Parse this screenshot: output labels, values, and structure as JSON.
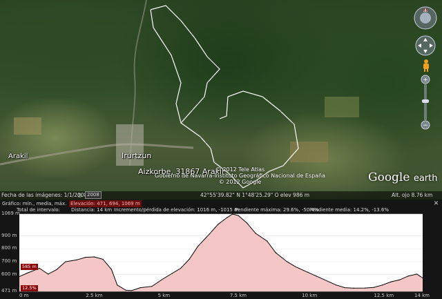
{
  "map": {
    "places": {
      "irurtzun": "Irurtzun",
      "arakil": "Arakil",
      "aizkorbe": "Aizkorbe, 31867 Arakil"
    },
    "attribution": {
      "line1": "© 2012 Tele Atlas",
      "line2": "Gobierno de Navarra-Instituto Geográfico Nacional de España",
      "line3": "© 2012 Google"
    },
    "logo": {
      "main": "Google",
      "suffix": "earth"
    },
    "status": {
      "imagery_date": "Fecha de las imágenes: 1/1/2008",
      "year": "2008",
      "coords": "42°55'39.82\" N    1°48'25.29\" O  elev  986 m",
      "eye_alt": "Alt. ojo    8.76 km"
    },
    "nav_icons": [
      "look-compass-icon",
      "move-compass-icon",
      "pegman-icon",
      "zoom-slider-icon"
    ]
  },
  "profile": {
    "toolbar": {
      "graph_label": "Gráfico: mín., media, máx.",
      "elevation": "Elevación: 471, 694, 1069 m",
      "total_label": "Total de intervalo:",
      "distance": "Distancia: 14 km",
      "gain_loss": "Incremento/pérdida de elevación: 1016 m, -1015 m",
      "max_slope": "Pendiente máxima: 29.6%, -50.4%",
      "avg_slope": "Pendiente media: 14.2%, -13.6%"
    },
    "y_ticks": [
      "1069 m",
      "900 m",
      "800 m",
      "700 m",
      "600 m",
      "471 m"
    ],
    "x_ticks": [
      "0 m",
      "2.5 km",
      "5 km",
      "7.5 km",
      "10 km",
      "12.5 km",
      "14 km"
    ],
    "current_elev_tag": "585 m",
    "current_slope_tag": "12.5%",
    "colors": {
      "fill": "#f4c6c6",
      "line": "#000000",
      "tag": "#8b0000"
    }
  },
  "chart_data": {
    "type": "area",
    "xlabel": "",
    "ylabel": "",
    "x_unit": "km",
    "y_unit": "m",
    "xlim": [
      0,
      14
    ],
    "ylim": [
      471,
      1069
    ],
    "x": [
      0,
      0.3,
      0.7,
      1.0,
      1.3,
      1.6,
      2.0,
      2.3,
      2.6,
      2.9,
      3.2,
      3.4,
      3.7,
      3.9,
      4.2,
      4.6,
      5.0,
      5.3,
      5.6,
      5.9,
      6.2,
      6.6,
      6.9,
      7.2,
      7.4,
      7.6,
      7.9,
      8.2,
      8.6,
      8.9,
      9.3,
      9.6,
      10.0,
      10.3,
      10.6,
      11.0,
      11.3,
      11.6,
      12.0,
      12.3,
      12.6,
      12.9,
      13.2,
      13.5,
      13.8,
      14.0
    ],
    "y": [
      585,
      615,
      650,
      605,
      640,
      700,
      715,
      735,
      738,
      720,
      640,
      520,
      480,
      478,
      500,
      510,
      570,
      610,
      650,
      720,
      820,
      915,
      990,
      1040,
      1069,
      1058,
      1000,
      920,
      860,
      770,
      700,
      660,
      620,
      590,
      560,
      520,
      500,
      496,
      497,
      502,
      520,
      545,
      560,
      590,
      605,
      575
    ]
  }
}
